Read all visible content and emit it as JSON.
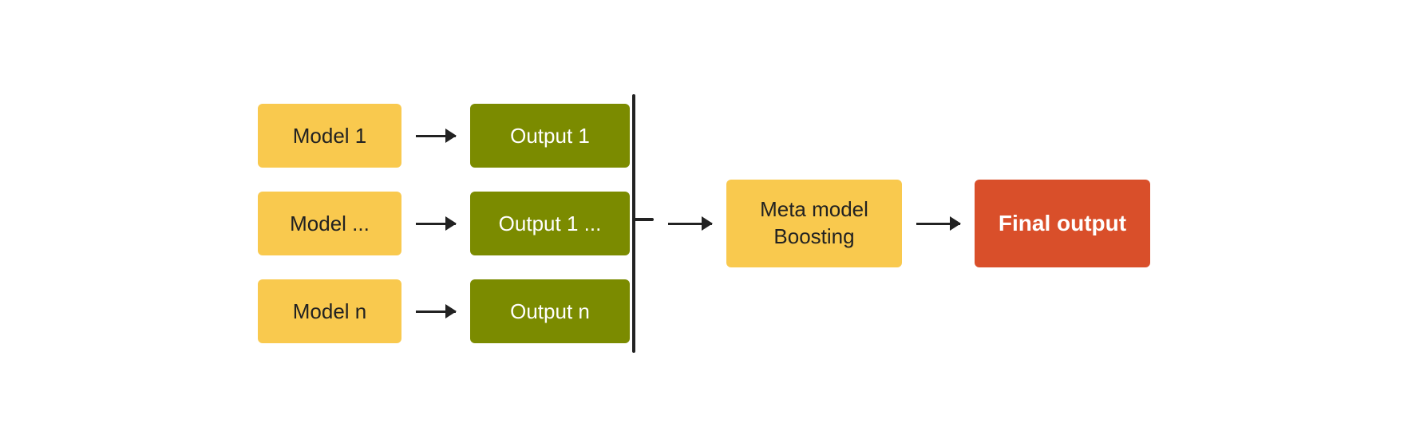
{
  "diagram": {
    "models": [
      {
        "label": "Model 1"
      },
      {
        "label": "Model ..."
      },
      {
        "label": "Model n"
      }
    ],
    "outputs": [
      {
        "label": "Output 1"
      },
      {
        "label": "Output 1 ..."
      },
      {
        "label": "Output n"
      }
    ],
    "meta": {
      "line1": "Meta model",
      "line2": "Boosting"
    },
    "final": {
      "label": "Final output"
    }
  },
  "colors": {
    "model_bg": "#F9C94E",
    "output_bg": "#7B8B00",
    "meta_bg": "#F9C94E",
    "final_bg": "#D94F2A",
    "arrow": "#222222",
    "output_text": "#ffffff",
    "final_text": "#ffffff",
    "model_text": "#222222",
    "meta_text": "#222222"
  }
}
